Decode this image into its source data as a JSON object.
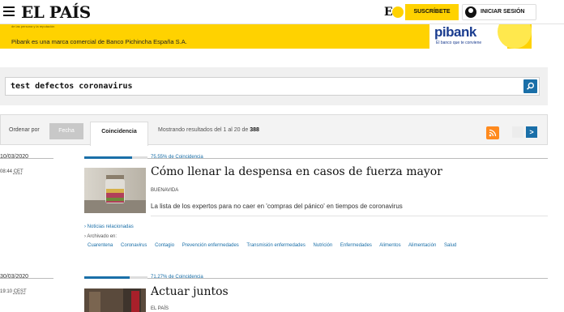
{
  "header": {
    "logo": "EL PAÍS",
    "eplus": "E",
    "subscribe": "SUSCRÍBETE",
    "login": "INICIAR SESIÓN"
  },
  "ad": {
    "small_text": "de las persona y la reputación",
    "text": "Pibank es una marca comercial de Banco Pichincha España S.A.",
    "logo": "pibank",
    "tagline": "El banco que te conviene"
  },
  "search": {
    "value": "test defectos coronavirus"
  },
  "sort": {
    "label": "Ordenar por",
    "tab_date": "Fecha",
    "tab_relevance": "Coincidencia",
    "results_prefix": "Mostrando resultados del 1 al 20 de",
    "results_total": "388"
  },
  "results": [
    {
      "date": "10/03/2020",
      "time": "08:44",
      "tz": "CET",
      "match_pct": 75.55,
      "match_label": "75.55% de Coincidencia",
      "title": "Cómo llenar la despensa en casos de fuerza mayor",
      "section": "BUENAVIDA",
      "summary": "La lista de los expertos para no caer en 'compras del pánico' en tiempos de coronavirus",
      "related": "Noticias relacionadas",
      "archived": "Archivado en:",
      "tags": [
        "Cuarentena",
        "Coronavirus",
        "Contagio",
        "Prevención enfermedades",
        "Transmisión enfermedades",
        "Nutrición",
        "Enfermedades",
        "Alimentos",
        "Alimentación",
        "Salud"
      ]
    },
    {
      "date": "30/03/2020",
      "time": "19:10",
      "tz": "CEST",
      "match_pct": 71.27,
      "match_label": "71.27% de Coincidencia",
      "title": "Actuar juntos",
      "section": "EL PAÍS"
    }
  ]
}
